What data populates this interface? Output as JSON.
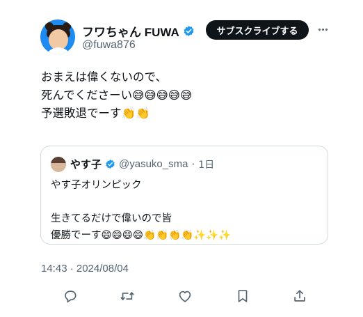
{
  "author": {
    "display_name": "フワちゃん FUWA",
    "handle": "@fuwa876",
    "avatar_icon": "avatar-photo",
    "verified_icon": "verified-badge-icon"
  },
  "header": {
    "subscribe_label": "サブスクライブする",
    "more_icon": "more-options-icon"
  },
  "tweet": {
    "text": "おまえは偉くないので、\n死んでくださーい😅😅😅😅😅\n予選敗退でーす👏👏"
  },
  "quote": {
    "display_name": "やす子",
    "handle": "@yasuko_sma",
    "separator": "·",
    "time": "1日",
    "text": "やす子オリンピック\n\n生きてるだけで偉いので皆\n優勝でーす😄😄😄😄👏👏👏👏✨✨✨"
  },
  "meta": {
    "timestamp": "14:43 · 2024/08/04"
  },
  "actions": [
    {
      "icon": "reply-icon"
    },
    {
      "icon": "retweet-icon"
    },
    {
      "icon": "like-icon"
    },
    {
      "icon": "bookmark-icon"
    },
    {
      "icon": "share-icon"
    }
  ],
  "colors": {
    "verified_blue": "#1d9bf0",
    "text_primary": "#0f1419",
    "text_secondary": "#536471",
    "border": "#cfd9de",
    "button_dark": "#0f1419"
  }
}
